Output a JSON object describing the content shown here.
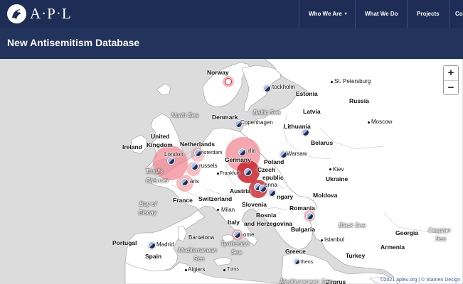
{
  "brand": {
    "logo_text": "A·P·L",
    "logo_mark": "apl-logo-icon"
  },
  "nav": {
    "items": [
      {
        "label": "Who We Are",
        "has_caret": true
      },
      {
        "label": "What We Do"
      },
      {
        "label": "Projects"
      },
      {
        "label": "Co"
      }
    ],
    "caret_glyph": "▾"
  },
  "header": {
    "title": "New Antisemitism Database"
  },
  "map": {
    "zoom_in": "+",
    "zoom_out": "−",
    "attribution": "©2021 apleu.org | © Stamen Design",
    "labels": {
      "norway": "Norway",
      "st_petersburg": "St. Petersburg",
      "stockholm": "tockholm",
      "estonia": "Estonia",
      "russia": "Russia",
      "north_sea": "North Sea",
      "denmark": "Denmark",
      "baltic_sea": "Baltic Sea",
      "latvia": "Latvia",
      "copenhagen": "Copenhagen",
      "moscow": "Moscow",
      "united": "United",
      "kingdom": "Kingdom",
      "lithuania": "Lithuania",
      "ireland": "Ireland",
      "netherlands": "Netherlands",
      "belarus": "Belarus",
      "london": "London",
      "amsterdam": "nsterdam",
      "berlin": "rlin",
      "warsaw": "Warsaw",
      "brussels": "russels",
      "germany": "Germany",
      "poland": "Poland",
      "english": "Englis",
      "channel": "Channel",
      "frankfurt": "Frankfurt",
      "czech": "Czech",
      "kiev": "Kiev",
      "republic": "epublic",
      "ukraine": "Ukraine",
      "paris": "aris",
      "vienna": "enna",
      "austria": "Austria",
      "hungary": "ngary",
      "moldova": "Moldova",
      "france": "France",
      "switzerland": "Switzerland",
      "bay_of": "Bay of",
      "biscay": "Biscay",
      "milan": "Milan",
      "slovenia": "Slovenia",
      "romania": "Romania",
      "bosnia": "Bosnia",
      "and_herzegovina": "and Herzegovina",
      "black_sea": "Black Sea",
      "italy": "Italy",
      "bulgaria": "Bulgaria",
      "georgia": "Georgia",
      "caspian": "Caspian",
      "sea": "Sea",
      "portugal": "Portugal",
      "madrid": "Madrid",
      "barcelona": "Barcelona",
      "rome": "ome",
      "istanbul": "Istanbul",
      "armenia": "Armenia",
      "tyrrhenian": "Tyrrhenian",
      "tyrrhenian_sea": "Sea",
      "spain": "Spain",
      "mediterranean": "Mediterranean",
      "mediterranean_sea": "Sea",
      "greece": "Greece",
      "turkey": "Turkey",
      "algiers": "Algiers",
      "tunis": "Tunis",
      "athens": "thens",
      "cyprus": "Cyprus",
      "mediterranean_bottom": "Mediterranean Sea"
    }
  },
  "colors": {
    "navbar": "#1d2d55",
    "titlebar": "#22335c",
    "land": "#ffffff",
    "water": "#dcdcdc",
    "marker_light": "#f08a94",
    "marker_dark": "#c8242e"
  }
}
